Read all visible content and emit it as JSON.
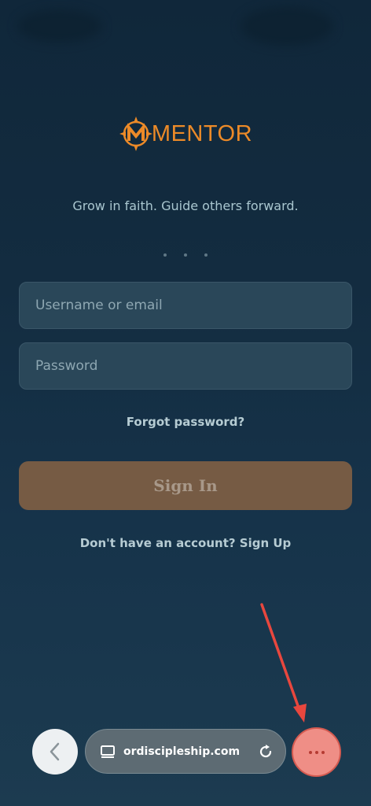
{
  "brand": {
    "name": "MENTOR",
    "color": "#ec8a28"
  },
  "tagline": "Grow in faith. Guide others forward.",
  "form": {
    "username_placeholder": "Username or email",
    "password_placeholder": "Password",
    "forgot_label": "Forgot password?",
    "signin_label": "Sign In",
    "signup_label": "Don't have an account? Sign Up"
  },
  "browser": {
    "url": "ordiscipleship.com",
    "back_icon": "chevron-left-icon",
    "tab_icon": "tabs-icon",
    "reload_icon": "reload-icon",
    "more_icon": "more-dots-icon"
  },
  "colors": {
    "accent": "#ec8a28",
    "signin_bg": "#765b44",
    "highlight": "#e8473e"
  }
}
